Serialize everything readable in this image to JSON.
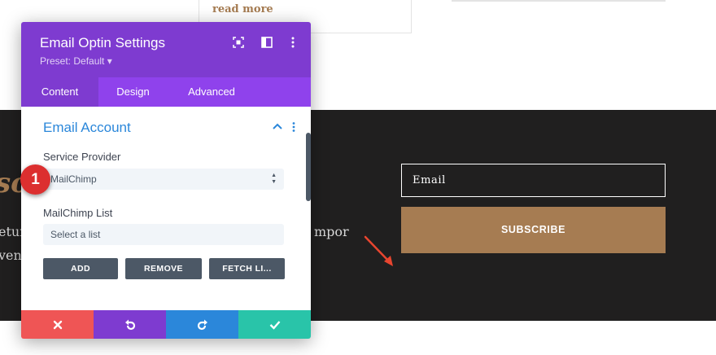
{
  "background": {
    "read_more": "read more",
    "heading_fragment": "so",
    "text_line_1": "etur",
    "text_line_2": "ven",
    "text_line_3": "mpor",
    "email_placeholder": "Email",
    "subscribe_label": "SUBSCRIBE"
  },
  "modal": {
    "title": "Email Optin Settings",
    "preset": "Preset: Default ▾",
    "tabs": [
      {
        "label": "Content"
      },
      {
        "label": "Design"
      },
      {
        "label": "Advanced"
      }
    ],
    "section_title": "Email Account",
    "service_provider_label": "Service Provider",
    "service_provider_value": "MailChimp",
    "list_label": "MailChimp List",
    "list_value": "Select a list",
    "buttons": {
      "add": "ADD",
      "remove": "REMOVE",
      "fetch": "FETCH LI..."
    }
  },
  "badge": "1",
  "colors": {
    "header_purple": "#7e3bd0",
    "tab_purple": "#8f42ec",
    "section_blue": "#2b87da",
    "cancel_red": "#ef5555",
    "undo_purple": "#7e3bd0",
    "redo_blue": "#2b87da",
    "save_green": "#29c4a9",
    "accent_brown": "#a67c52",
    "dark_bg": "#201f1f"
  }
}
